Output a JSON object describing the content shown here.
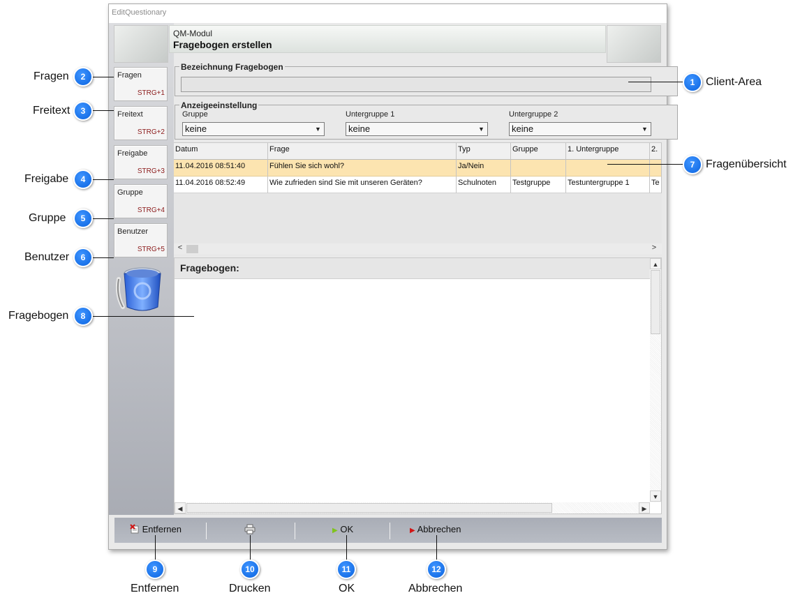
{
  "window": {
    "title": "EditQuestionary"
  },
  "header": {
    "subtitle": "QM-Modul",
    "title": "Fragebogen erstellen"
  },
  "sidebar": {
    "items": [
      {
        "label": "Fragen",
        "shortcut": "STRG+1"
      },
      {
        "label": "Freitext",
        "shortcut": "STRG+2"
      },
      {
        "label": "Freigabe",
        "shortcut": "STRG+3"
      },
      {
        "label": "Gruppe",
        "shortcut": "STRG+4"
      },
      {
        "label": "Benutzer",
        "shortcut": "STRG+5"
      }
    ],
    "trash_icon": "recycle-bin-icon"
  },
  "bezeichnung": {
    "legend": "Bezeichnung Fragebogen",
    "value": ""
  },
  "anzeige": {
    "legend": "Anzeigeeinstellung",
    "fields": [
      {
        "label": "Gruppe",
        "value": "keine"
      },
      {
        "label": "Untergruppe 1",
        "value": "keine"
      },
      {
        "label": "Untergruppe 2",
        "value": "keine"
      }
    ]
  },
  "grid": {
    "columns": [
      "Datum",
      "Frage",
      "Typ",
      "Gruppe",
      "1. Untergruppe",
      "2."
    ],
    "rows": [
      [
        "11.04.2016 08:51:40",
        "Fühlen Sie sich wohl?",
        "Ja/Nein",
        "",
        "",
        ""
      ],
      [
        "11.04.2016 08:52:49",
        "Wie zufrieden sind Sie mit unseren Geräten?",
        "Schulnoten",
        "Testgruppe",
        "Testuntergruppe 1",
        "Te"
      ]
    ],
    "selected_row_color": "#fce4b0"
  },
  "fragebogen": {
    "title": "Fragebogen:"
  },
  "toolbar": {
    "remove_label": "Entfernen",
    "ok_label": "OK",
    "cancel_label": "Abbrechen",
    "print_icon": "printer-icon"
  },
  "callouts": {
    "c1": {
      "num": "1",
      "text": "Client-Area"
    },
    "c2": {
      "num": "2",
      "text": "Fragen"
    },
    "c3": {
      "num": "3",
      "text": "Freitext"
    },
    "c4": {
      "num": "4",
      "text": "Freigabe"
    },
    "c5": {
      "num": "5",
      "text": "Gruppe"
    },
    "c6": {
      "num": "6",
      "text": "Benutzer"
    },
    "c7": {
      "num": "7",
      "text": "Fragenübersicht"
    },
    "c8": {
      "num": "8",
      "text": "Fragebogen"
    },
    "c9": {
      "num": "9",
      "text": "Entfernen"
    },
    "c10": {
      "num": "10",
      "text": "Drucken"
    },
    "c11": {
      "num": "11",
      "text": "OK"
    },
    "c12": {
      "num": "12",
      "text": "Abbrechen"
    }
  },
  "colors": {
    "badge": "#0a63e0",
    "shortcut": "#8b1a1a",
    "ok_arrow": "#7fc31c",
    "cancel_arrow": "#d11414"
  }
}
